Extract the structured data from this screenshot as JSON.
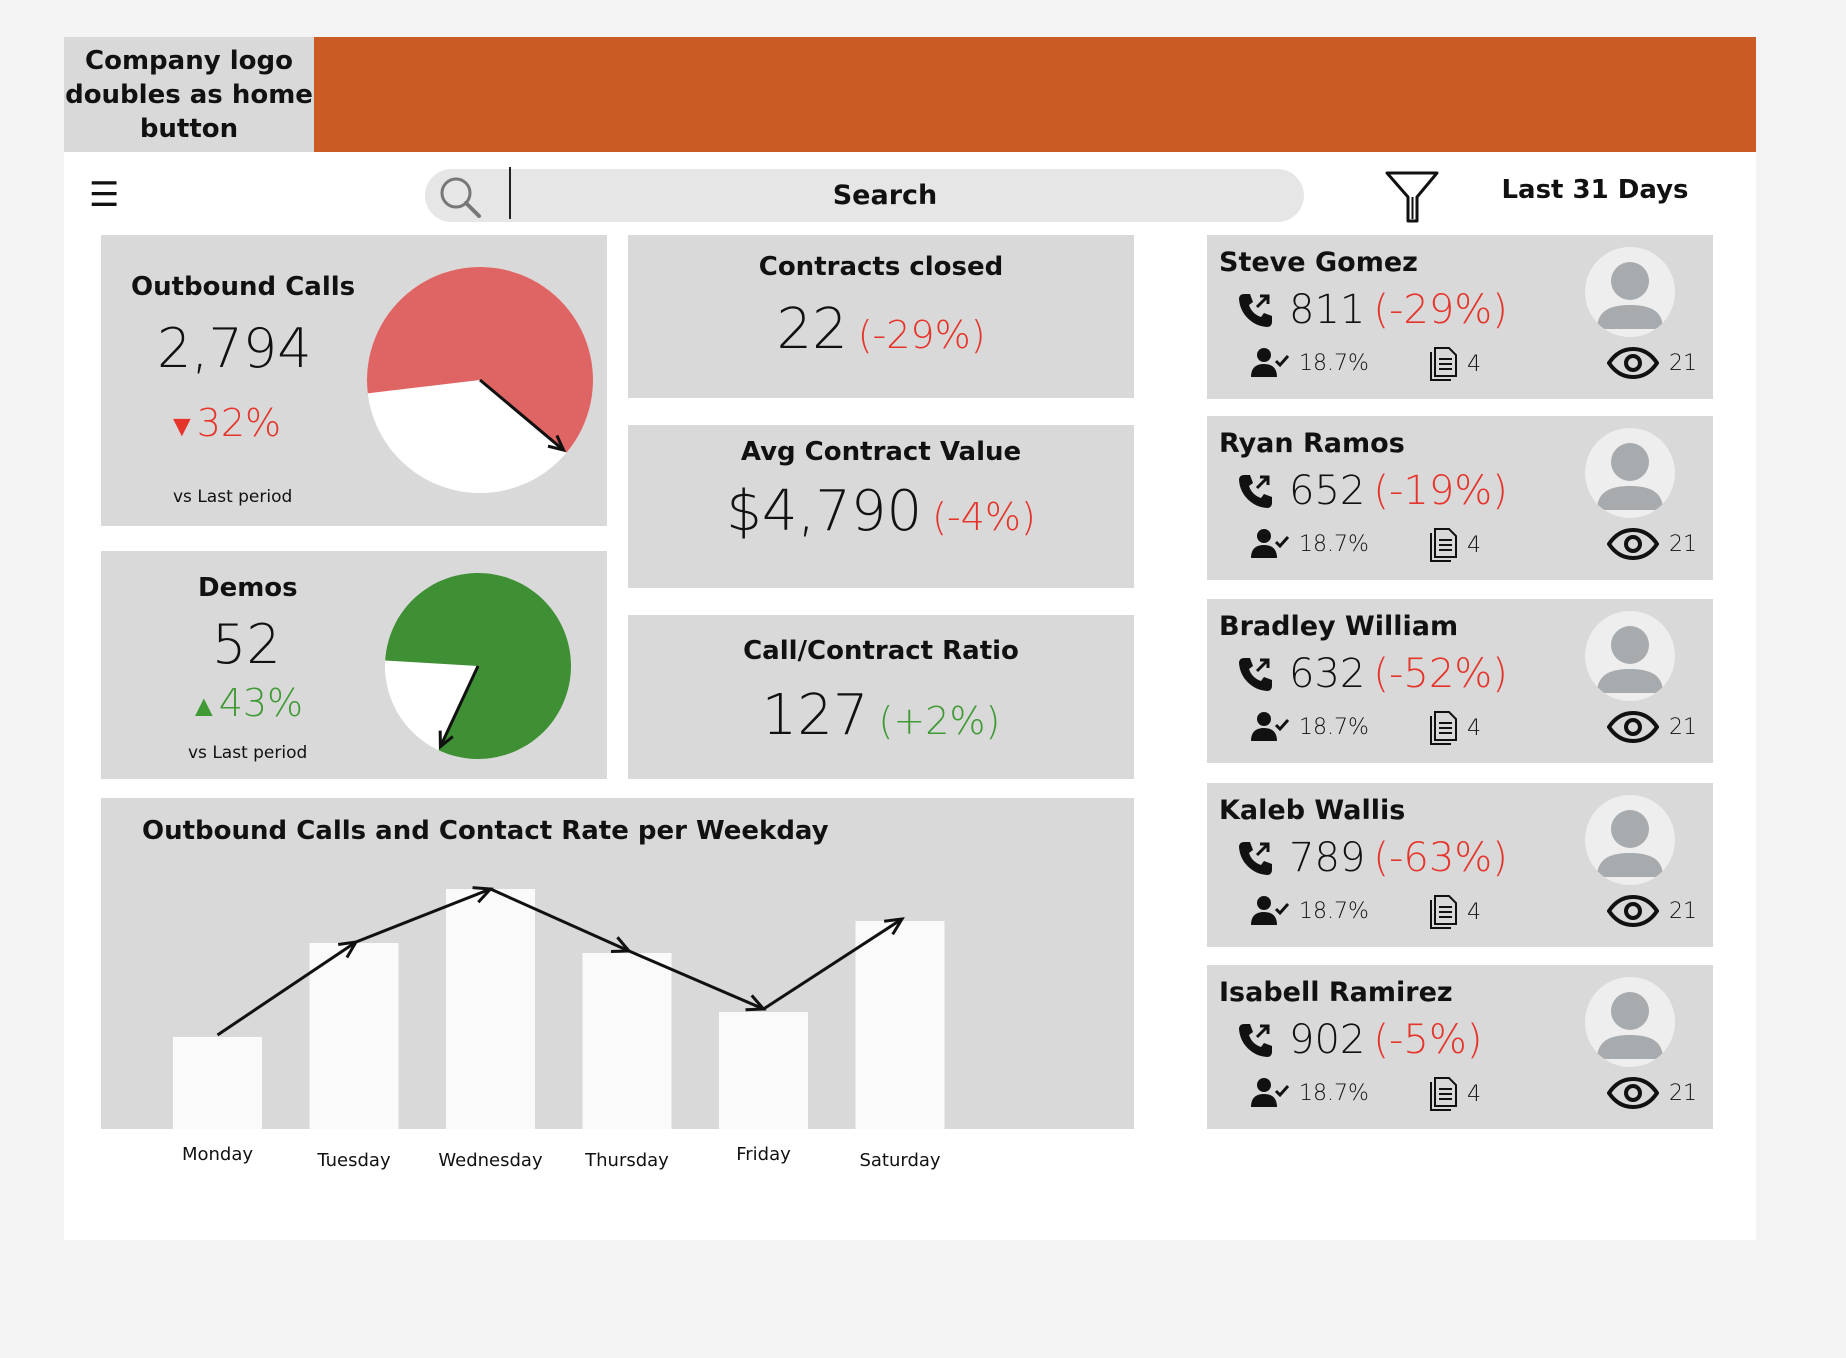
{
  "header": {
    "logo_text": "Company logo doubles as home button",
    "brand_color": "#ca5b25",
    "search_placeholder": "Search",
    "date_range": "Last 31 Days"
  },
  "kpis": {
    "outbound_calls": {
      "title": "Outbound Calls",
      "value": "2,794",
      "change": "32%",
      "direction": "down",
      "subtitle": "vs Last period",
      "pie_fraction": 0.37
    },
    "demos": {
      "title": "Demos",
      "value": "52",
      "change": "43%",
      "direction": "up",
      "subtitle": "vs Last period",
      "pie_fraction": 0.81
    },
    "contracts_closed": {
      "title": "Contracts closed",
      "value": "22",
      "change": "(-29%)"
    },
    "avg_contract_value": {
      "title": "Avg Contract Value",
      "value": "$4,790",
      "change": "(-4%)"
    },
    "call_contract_ratio": {
      "title": "Call/Contract Ratio",
      "value": "127",
      "change": "(+2%)"
    }
  },
  "people": [
    {
      "name": "Steve Gomez",
      "calls": "811",
      "change": "(-29%)",
      "contact_rate": "18.7%",
      "documents": "4",
      "views": "21"
    },
    {
      "name": "Ryan Ramos",
      "calls": "652",
      "change": "(-19%)",
      "contact_rate": "18.7%",
      "documents": "4",
      "views": "21"
    },
    {
      "name": "Bradley William",
      "calls": "632",
      "change": "(-52%)",
      "contact_rate": "18.7%",
      "documents": "4",
      "views": "21"
    },
    {
      "name": "Kaleb Wallis",
      "calls": "789",
      "change": "(-63%)",
      "contact_rate": "18.7%",
      "documents": "4",
      "views": "21"
    },
    {
      "name": "Isabell Ramirez",
      "calls": "902",
      "change": "(-5%)",
      "contact_rate": "18.7%",
      "documents": "4",
      "views": "21"
    }
  ],
  "chart_data": {
    "type": "bar",
    "title": "Outbound Calls and Contact Rate per Weekday",
    "categories": [
      "Monday",
      "Tuesday",
      "Wednesday",
      "Thursday",
      "Friday",
      "Saturday"
    ],
    "series": [
      {
        "type": "bar",
        "values": [
          92,
          186,
          240,
          176,
          117,
          208
        ]
      },
      {
        "type": "line",
        "values": [
          94,
          187,
          240,
          178,
          120,
          210
        ]
      }
    ],
    "ylim": [
      0,
      250
    ],
    "grid": false,
    "bar_color": "#fafafa",
    "line_color": "#111111"
  },
  "colors": {
    "down": "#e5352b",
    "up": "#3f9a35",
    "card": "#d9d9d9",
    "pie_red": "#df6564",
    "pie_green": "#3f8f34"
  }
}
